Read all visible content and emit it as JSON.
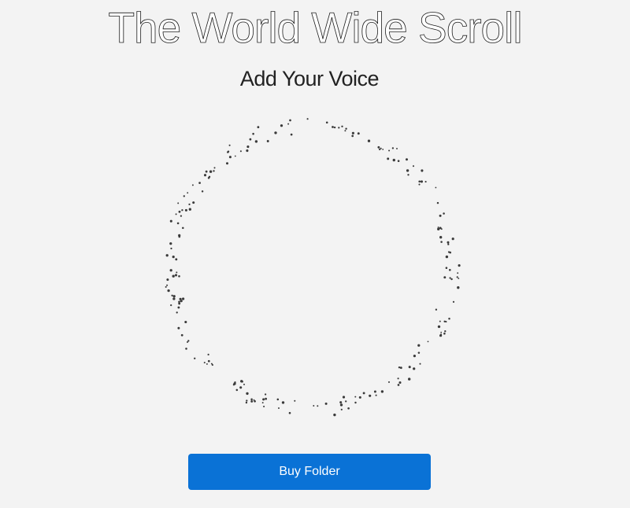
{
  "header": {
    "title": "The World Wide Scroll",
    "subtitle": "Add Your Voice"
  },
  "signature_circle": {
    "dot_color": "#3a3a3a"
  },
  "actions": {
    "buy_label": "Buy Folder",
    "button_color": "#0a72d6"
  }
}
